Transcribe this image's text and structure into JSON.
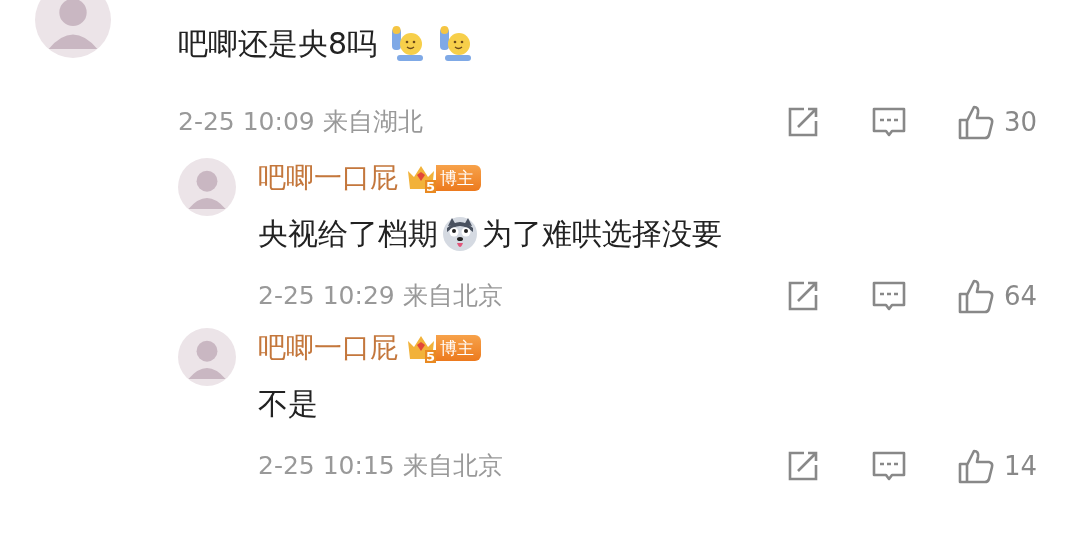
{
  "comment": {
    "message": [
      {
        "kind": "text",
        "text": "吧唧还是央8吗"
      },
      {
        "kind": "hand-emoji"
      },
      {
        "kind": "hand-emoji"
      }
    ],
    "time": "2-25 10:09",
    "location": "来自湖北",
    "likes": "30",
    "replies": [
      {
        "user": "吧唧一口屁",
        "badge": {
          "rank": "5",
          "label": "博主"
        },
        "message": [
          {
            "kind": "text",
            "text": "央视给了档期"
          },
          {
            "kind": "dog-emoji"
          },
          {
            "kind": "text",
            "text": "为了难哄选择没要"
          }
        ],
        "time": "2-25 10:29",
        "location": "来自北京",
        "likes": "64"
      },
      {
        "user": "吧唧一口屁",
        "badge": {
          "rank": "5",
          "label": "博主"
        },
        "message": [
          {
            "kind": "text",
            "text": "不是"
          }
        ],
        "time": "2-25 10:15",
        "location": "来自北京",
        "likes": "14"
      }
    ]
  }
}
